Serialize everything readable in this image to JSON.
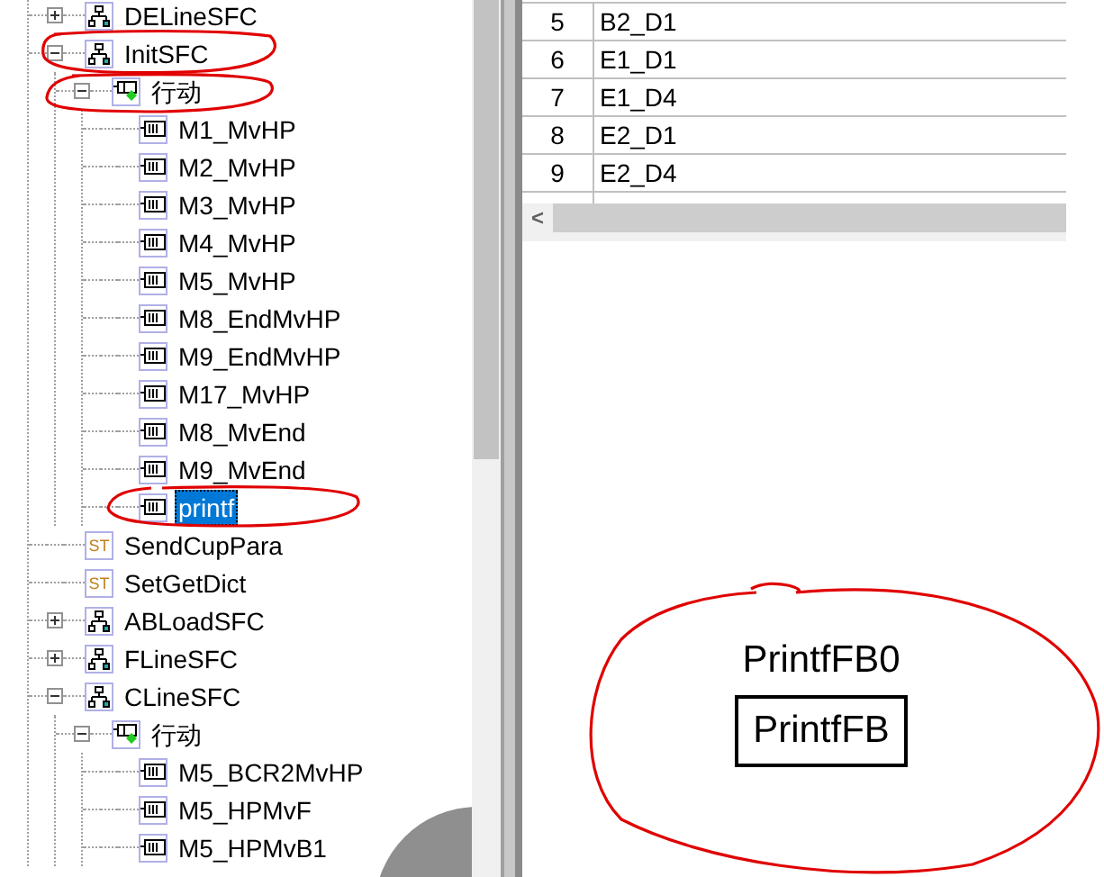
{
  "tree": [
    {
      "label": "DELineSFC",
      "kind": "sfc",
      "expanded": false,
      "selected": false
    },
    {
      "label": "InitSFC",
      "kind": "sfc",
      "expanded": true,
      "selected": false,
      "children": [
        {
          "label": "行动",
          "kind": "action_group",
          "expanded": true,
          "selected": false,
          "children": [
            {
              "label": "M1_MvHP",
              "kind": "action",
              "selected": false
            },
            {
              "label": "M2_MvHP",
              "kind": "action",
              "selected": false
            },
            {
              "label": "M3_MvHP",
              "kind": "action",
              "selected": false
            },
            {
              "label": "M4_MvHP",
              "kind": "action",
              "selected": false
            },
            {
              "label": "M5_MvHP",
              "kind": "action",
              "selected": false
            },
            {
              "label": "M8_EndMvHP",
              "kind": "action",
              "selected": false
            },
            {
              "label": "M9_EndMvHP",
              "kind": "action",
              "selected": false
            },
            {
              "label": "M17_MvHP",
              "kind": "action",
              "selected": false
            },
            {
              "label": "M8_MvEnd",
              "kind": "action",
              "selected": false
            },
            {
              "label": "M9_MvEnd",
              "kind": "action",
              "selected": false
            },
            {
              "label": "printf",
              "kind": "action",
              "selected": true
            }
          ]
        }
      ]
    },
    {
      "label": "SendCupPara",
      "kind": "st",
      "icon_text": "ST",
      "selected": false
    },
    {
      "label": "SetGetDict",
      "kind": "st",
      "icon_text": "ST",
      "selected": false
    },
    {
      "label": "ABLoadSFC",
      "kind": "sfc",
      "expanded": false,
      "selected": false
    },
    {
      "label": "FLineSFC",
      "kind": "sfc",
      "expanded": false,
      "selected": false
    },
    {
      "label": "CLineSFC",
      "kind": "sfc",
      "expanded": true,
      "selected": false,
      "children": [
        {
          "label": "行动",
          "kind": "action_group",
          "expanded": true,
          "selected": false,
          "children": [
            {
              "label": "M5_BCR2MvHP",
              "kind": "action",
              "selected": false
            },
            {
              "label": "M5_HPMvF",
              "kind": "action",
              "selected": false
            },
            {
              "label": "M5_HPMvB1",
              "kind": "action",
              "selected": false
            }
          ]
        }
      ]
    }
  ],
  "table": {
    "rows": [
      {
        "index": "5",
        "name": "B2_D1"
      },
      {
        "index": "6",
        "name": "E1_D1"
      },
      {
        "index": "7",
        "name": "E1_D4"
      },
      {
        "index": "8",
        "name": "E2_D1"
      },
      {
        "index": "9",
        "name": "E2_D4"
      }
    ]
  },
  "scroll_left": "<",
  "block": {
    "instance_name": "PrintfFB0",
    "type_name": "PrintfFB"
  }
}
